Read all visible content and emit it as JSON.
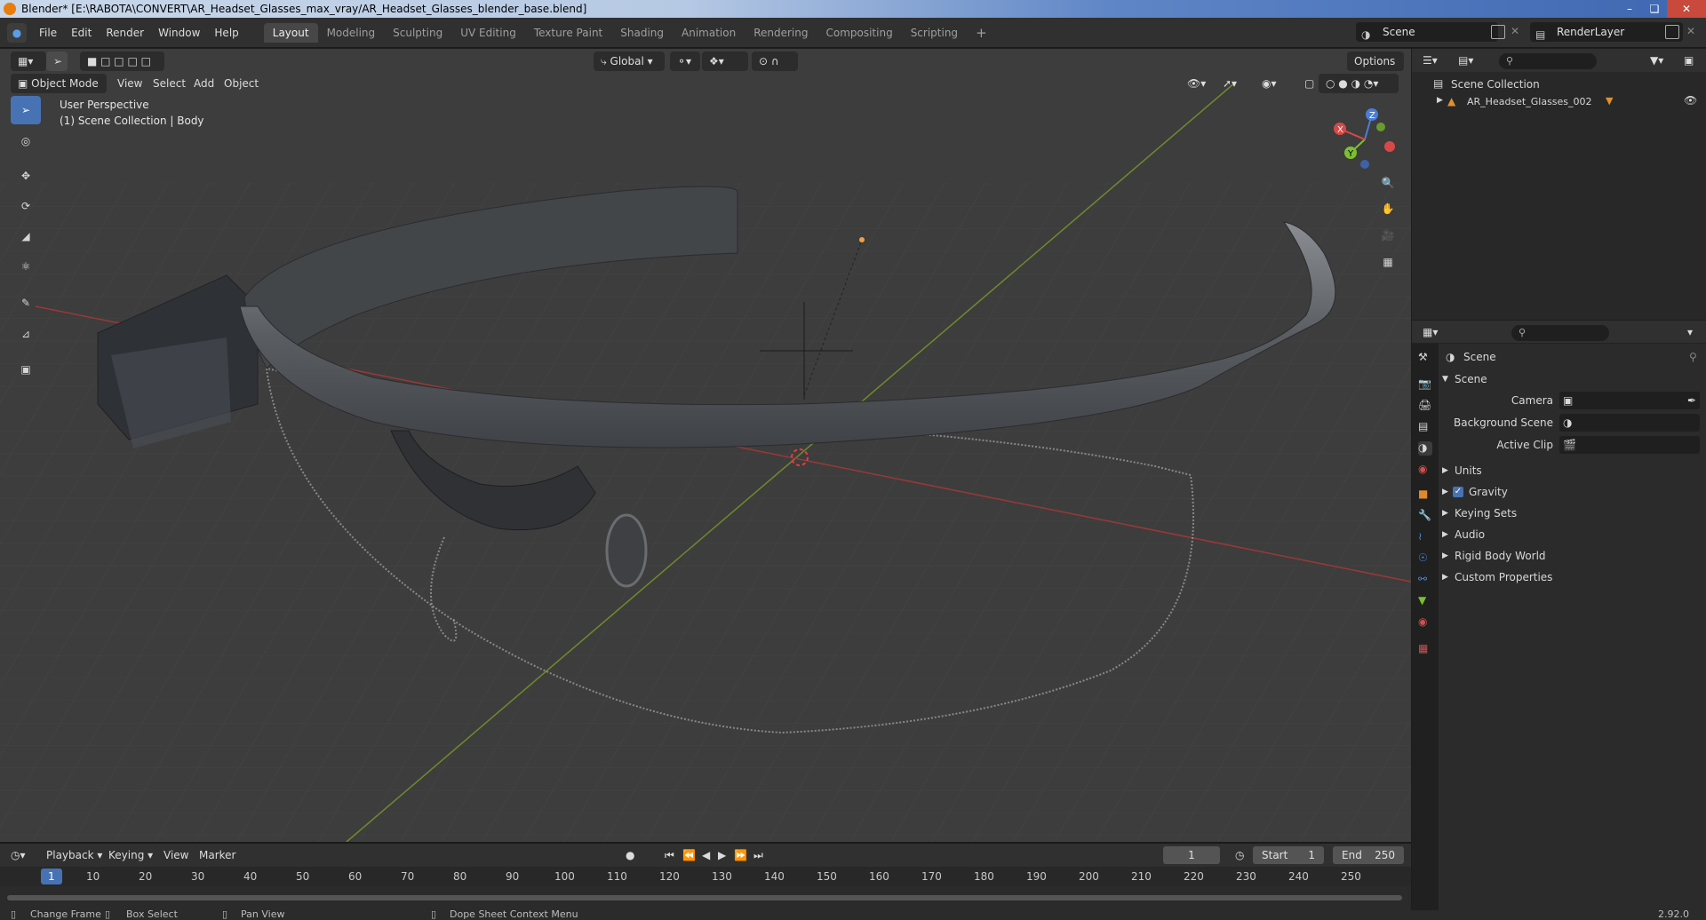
{
  "window": {
    "title": "Blender* [E:\\RABOTA\\CONVERT\\AR_Headset_Glasses_max_vray/AR_Headset_Glasses_blender_base.blend]"
  },
  "menu": [
    "File",
    "Edit",
    "Render",
    "Window",
    "Help"
  ],
  "workspaces": [
    "Layout",
    "Modeling",
    "Sculpting",
    "UV Editing",
    "Texture Paint",
    "Shading",
    "Animation",
    "Rendering",
    "Compositing",
    "Scripting"
  ],
  "active_workspace": "Layout",
  "scene_selector": "Scene",
  "view_layer_selector": "RenderLayer",
  "viewport": {
    "mode": "Object Mode",
    "menus": [
      "View",
      "Select",
      "Add",
      "Object"
    ],
    "orientation": "Global",
    "options_label": "Options",
    "overlay_title": "User Perspective",
    "overlay_subtitle": "(1) Scene Collection | Body",
    "gizmo": {
      "z": "Z",
      "y": "Y",
      "x": "X"
    }
  },
  "outliner": {
    "root": "Scene Collection",
    "items": [
      {
        "label": "AR_Headset_Glasses_002"
      }
    ]
  },
  "properties": {
    "context_title": "Scene",
    "panel_title": "Scene",
    "fields": [
      {
        "label": "Camera"
      },
      {
        "label": "Background Scene"
      },
      {
        "label": "Active Clip"
      }
    ],
    "subpanels": [
      {
        "label": "Units",
        "checkbox": false
      },
      {
        "label": "Gravity",
        "checkbox": true,
        "checked": true
      },
      {
        "label": "Keying Sets",
        "checkbox": false
      },
      {
        "label": "Audio",
        "checkbox": false
      },
      {
        "label": "Rigid Body World",
        "checkbox": false
      },
      {
        "label": "Custom Properties",
        "checkbox": false
      }
    ]
  },
  "timeline": {
    "menus": [
      "Playback",
      "Keying",
      "View",
      "Marker"
    ],
    "current_frame": "1",
    "start_label": "Start",
    "start": "1",
    "end_label": "End",
    "end": "250",
    "ruler": [
      "1",
      "10",
      "20",
      "30",
      "40",
      "50",
      "60",
      "70",
      "80",
      "90",
      "100",
      "110",
      "120",
      "130",
      "140",
      "150",
      "160",
      "170",
      "180",
      "190",
      "200",
      "210",
      "220",
      "230",
      "240",
      "250"
    ]
  },
  "statusbar": {
    "items": [
      "Change Frame",
      "Box Select",
      "Pan View",
      "Dope Sheet Context Menu"
    ],
    "version": "2.92.0"
  }
}
